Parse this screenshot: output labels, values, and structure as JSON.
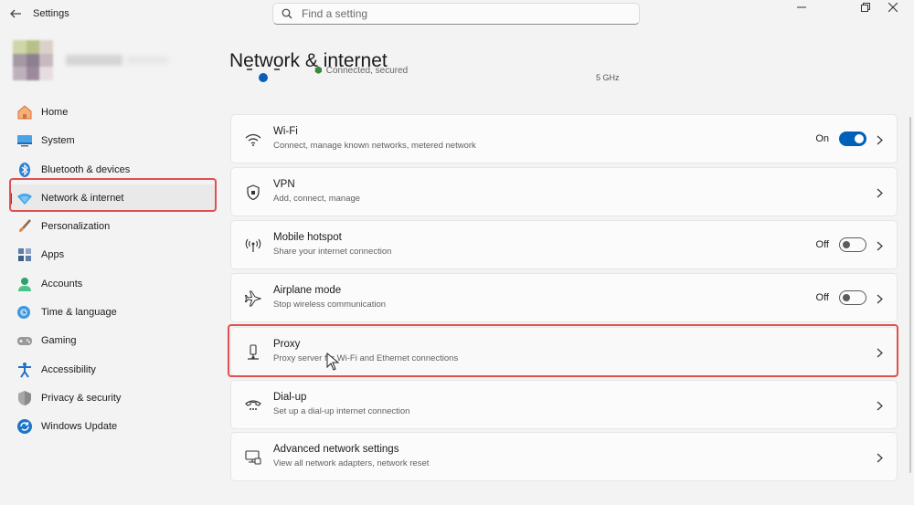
{
  "window": {
    "app_title": "Settings"
  },
  "search": {
    "placeholder": "Find a setting"
  },
  "sidebar": {
    "items": [
      {
        "label": "Home",
        "icon": "home-icon",
        "color": "#e8844a"
      },
      {
        "label": "System",
        "icon": "system-icon",
        "color": "#2b8ad6"
      },
      {
        "label": "Bluetooth & devices",
        "icon": "bluetooth-icon",
        "color": "#2b7fd4"
      },
      {
        "label": "Network & internet",
        "icon": "wifi-diamond-icon",
        "color": "#2b8ad6"
      },
      {
        "label": "Personalization",
        "icon": "brush-icon",
        "color": "#e0884a"
      },
      {
        "label": "Apps",
        "icon": "apps-icon",
        "color": "#4a6e9a"
      },
      {
        "label": "Accounts",
        "icon": "accounts-icon",
        "color": "#2aa36b"
      },
      {
        "label": "Time & language",
        "icon": "globe-clock-icon",
        "color": "#2b8ad6"
      },
      {
        "label": "Gaming",
        "icon": "gamepad-icon",
        "color": "#8a8a8a"
      },
      {
        "label": "Accessibility",
        "icon": "accessibility-icon",
        "color": "#1f6fc4"
      },
      {
        "label": "Privacy & security",
        "icon": "shield-icon",
        "color": "#7a7a7a"
      },
      {
        "label": "Windows Update",
        "icon": "update-icon",
        "color": "#1f74c9"
      }
    ],
    "active_index": 3
  },
  "main": {
    "title": "Network & internet",
    "connection": {
      "status": "Connected, secured",
      "band": "5 GHz"
    },
    "cards": [
      {
        "title": "Wi-Fi",
        "subtitle": "Connect, manage known networks, metered network",
        "icon": "wifi-icon",
        "toggle": {
          "state_label": "On",
          "on": true
        }
      },
      {
        "title": "VPN",
        "subtitle": "Add, connect, manage",
        "icon": "vpn-shield-icon"
      },
      {
        "title": "Mobile hotspot",
        "subtitle": "Share your internet connection",
        "icon": "hotspot-icon",
        "toggle": {
          "state_label": "Off",
          "on": false
        }
      },
      {
        "title": "Airplane mode",
        "subtitle": "Stop wireless communication",
        "icon": "airplane-icon",
        "toggle": {
          "state_label": "Off",
          "on": false
        }
      },
      {
        "title": "Proxy",
        "subtitle": "Proxy server for Wi-Fi and Ethernet connections",
        "icon": "proxy-icon"
      },
      {
        "title": "Dial-up",
        "subtitle": "Set up a dial-up internet connection",
        "icon": "dialup-icon"
      },
      {
        "title": "Advanced network settings",
        "subtitle": "View all network adapters, network reset",
        "icon": "advanced-network-icon"
      }
    ]
  },
  "colors": {
    "accent": "#005fb8",
    "highlight_box": "#e05050"
  }
}
